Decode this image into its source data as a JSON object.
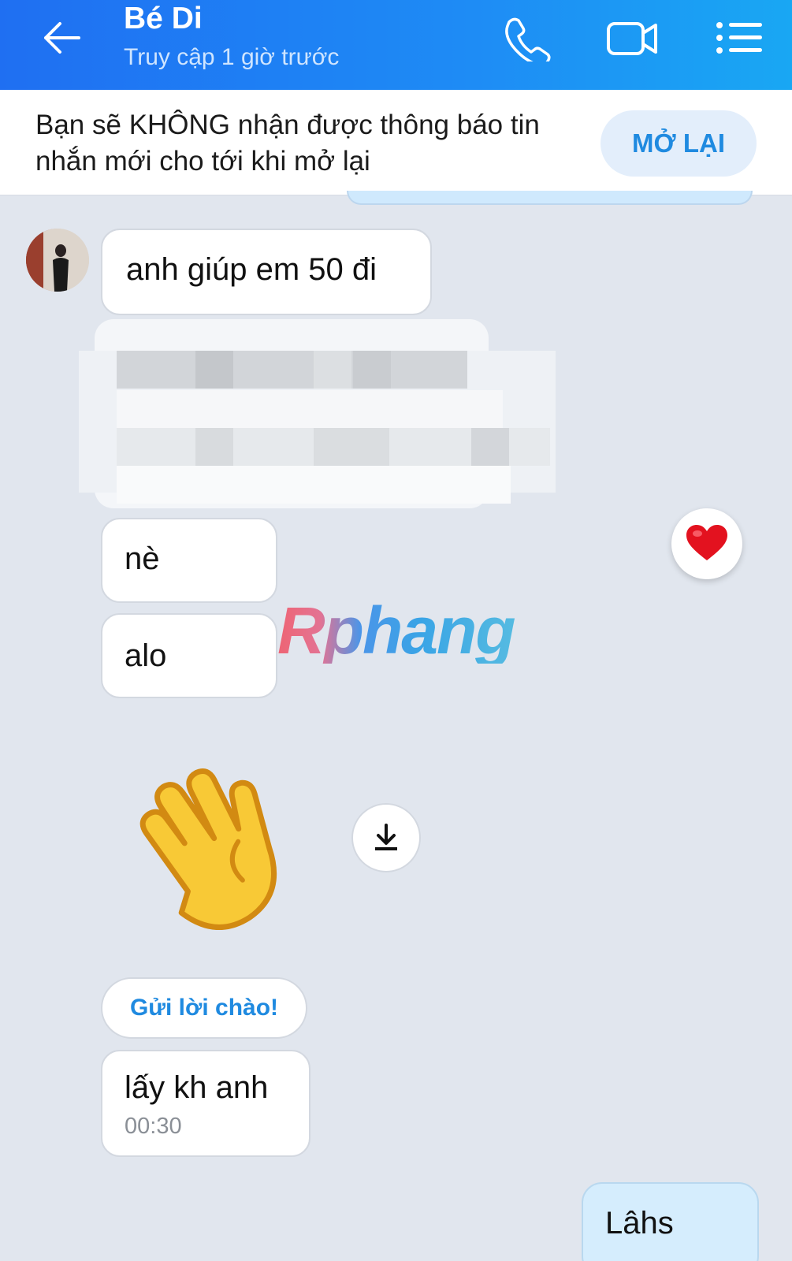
{
  "header": {
    "title": "Bé Di",
    "status": "Truy cập 1 giờ trước",
    "background_colors": [
      "#1f6ff2",
      "#19a7f3"
    ],
    "icons": [
      "back-arrow-icon",
      "phone-icon",
      "video-camera-icon",
      "menu-list-icon"
    ]
  },
  "notice": {
    "text": "Bạn sẽ KHÔNG nhận được thông báo tin nhắn mới cho tới khi mở lại",
    "button_label": "MỞ LẠI"
  },
  "messages": {
    "m1": "anh giúp em 50 đi",
    "m2": "nè",
    "m3": "alo",
    "reaction_icon": "heart-icon",
    "sticker_icon": "waving-hand-icon",
    "greet_label": "Gửi lời chào!",
    "m4": "lấy kh anh",
    "m4_time": "00:30",
    "sent_text": "Lâhs"
  },
  "watermark": {
    "text": "Rphang"
  }
}
